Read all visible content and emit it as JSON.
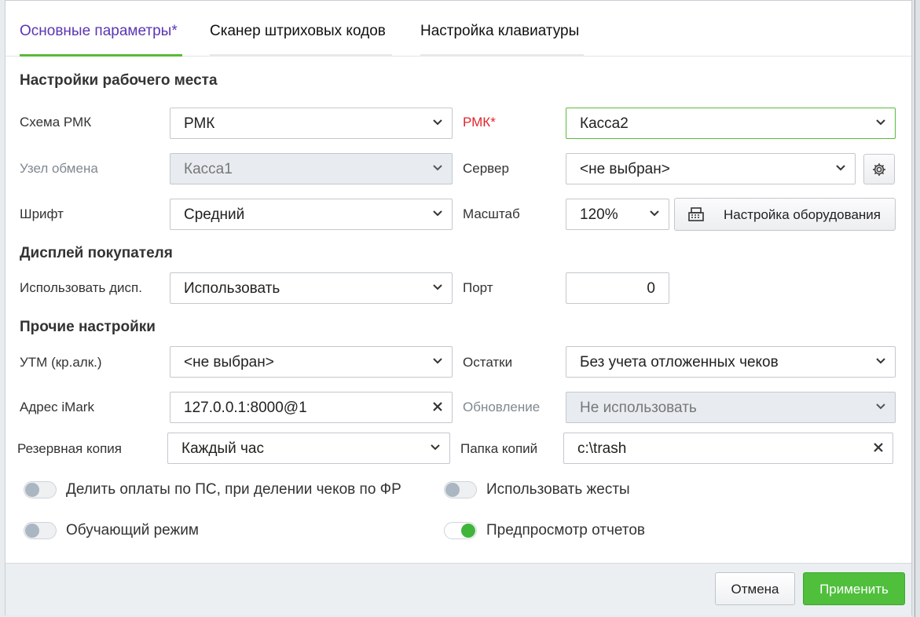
{
  "tabs": [
    {
      "label": "Основные параметры*",
      "active": true
    },
    {
      "label": "Сканер штриховых кодов",
      "active": false
    },
    {
      "label": "Настройка клавиатуры",
      "active": false
    }
  ],
  "colors": {
    "accent_tab": "#5a35b5",
    "underline": "#5cb93a",
    "required": "#e0262e",
    "apply": "#4fbf3c"
  },
  "sections": {
    "workplace": "Настройки рабочего места",
    "display": "Дисплей покупателя",
    "other": "Прочие настройки"
  },
  "workplace": {
    "scheme_label": "Схема РМК",
    "scheme_value": "РМК",
    "rmk_label": "РМК*",
    "rmk_value": "Касса2",
    "node_label": "Узел обмена",
    "node_value": "Касса1",
    "server_label": "Сервер",
    "server_value": "<не выбран>",
    "font_label": "Шрифт",
    "font_value": "Средний",
    "scale_label": "Масштаб",
    "scale_value": "120%",
    "equipment_button": "Настройка оборудования"
  },
  "display": {
    "use_label": "Использовать дисп.",
    "use_value": "Использовать",
    "port_label": "Порт",
    "port_value": "0"
  },
  "other": {
    "utm_label": "УТМ (кр.алк.)",
    "utm_value": "<не выбран>",
    "stock_label": "Остатки",
    "stock_value": "Без учета отложенных чеков",
    "imark_label": "Адрес iMark",
    "imark_value": "127.0.0.1:8000@1",
    "update_label": "Обновление",
    "update_value": "Не использовать",
    "backup_label": "Резервная копия",
    "backup_value": "Каждый час",
    "folder_label": "Папка копий",
    "folder_value": "c:\\trash"
  },
  "toggles": [
    {
      "label": "Делить оплаты по ПС, при делении чеков по ФР",
      "on": false
    },
    {
      "label": "Использовать жесты",
      "on": false
    },
    {
      "label": "Обучающий режим",
      "on": false
    },
    {
      "label": "Предпросмотр отчетов",
      "on": true
    }
  ],
  "footer": {
    "cancel": "Отмена",
    "apply": "Применить"
  }
}
